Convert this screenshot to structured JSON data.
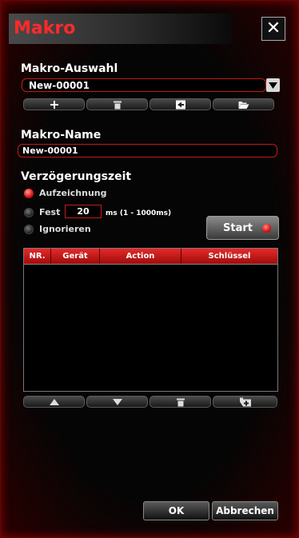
{
  "window": {
    "title": "Makro"
  },
  "macro_selection": {
    "label": "Makro-Auswahl",
    "selected": "New-00001"
  },
  "macro_name": {
    "label": "Makro-Name",
    "value": "New-00001"
  },
  "delay": {
    "label": "Verzögerungszeit",
    "options": [
      "Aufzeichnung",
      "Fest",
      "Ignorieren"
    ],
    "selected": "Aufzeichnung",
    "fixed_value": "20",
    "unit": "ms (1 - 1000ms)"
  },
  "start_button": {
    "label": "Start"
  },
  "table": {
    "columns": [
      "NR.",
      "Gerät",
      "Action",
      "Schlüssel"
    ],
    "rows": []
  },
  "footer": {
    "ok": "OK",
    "cancel": "Abbrechen"
  },
  "icons": [
    "close-icon",
    "dropdown-arrow-icon",
    "plus-icon",
    "trash-icon",
    "import-icon",
    "folder-open-icon",
    "arrow-up-icon",
    "arrow-down-icon",
    "trash-icon",
    "insert-icon",
    "record-led-icon"
  ]
}
